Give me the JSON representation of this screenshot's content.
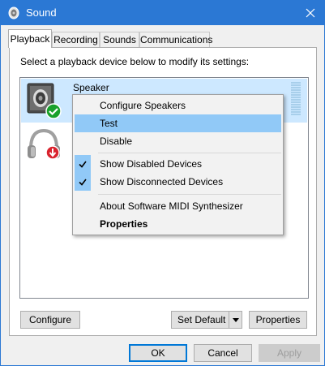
{
  "window": {
    "title": "Sound",
    "icon": "speaker-icon"
  },
  "tabs": [
    {
      "label": "Playback",
      "active": true
    },
    {
      "label": "Recording"
    },
    {
      "label": "Sounds"
    },
    {
      "label": "Communications"
    }
  ],
  "playback": {
    "instruction": "Select a playback device below to modify its settings:",
    "devices": [
      {
        "label": "Speaker",
        "icon": "speaker-icon",
        "status_icon": "default-device-check-icon",
        "selected": true
      },
      {
        "label": "",
        "icon": "headphones-icon",
        "status_icon": "disconnected-arrow-icon"
      }
    ]
  },
  "context_menu": {
    "items": [
      {
        "label": "Configure Speakers"
      },
      {
        "label": "Test",
        "highlighted": true
      },
      {
        "label": "Disable"
      },
      {
        "label": "Show Disabled Devices",
        "checked": true
      },
      {
        "label": "Show Disconnected Devices",
        "checked": true
      },
      {
        "label": "About Software MIDI Synthesizer"
      },
      {
        "label": "Properties",
        "bold": true
      }
    ]
  },
  "panel_buttons": {
    "configure": "Configure",
    "set_default": "Set Default",
    "properties": "Properties"
  },
  "dialog_buttons": {
    "ok": "OK",
    "cancel": "Cancel",
    "apply": "Apply"
  },
  "colors": {
    "titlebar": "#2b78d4",
    "selection": "#cde8ff",
    "menu_highlight": "#91c9f7",
    "accent": "#0078d7"
  }
}
